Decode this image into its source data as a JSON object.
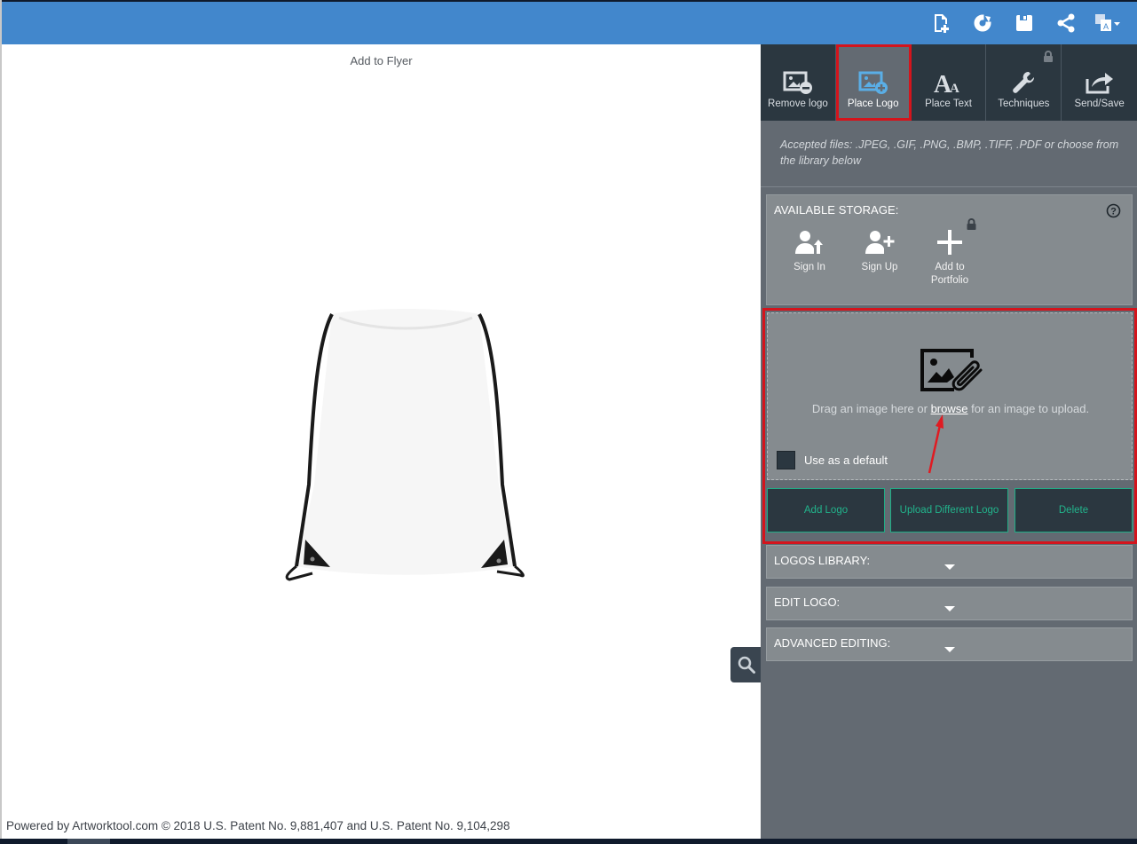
{
  "topbar": {
    "color": "#4287cc",
    "icons": [
      {
        "name": "new-document-icon"
      },
      {
        "name": "refresh-icon"
      },
      {
        "name": "save-icon"
      },
      {
        "name": "share-icon"
      },
      {
        "name": "translate-icon"
      }
    ]
  },
  "canvas": {
    "title": "Add to Flyer",
    "product": "white drawstring bag",
    "footer": "Powered by Artworktool.com © 2018 U.S. Patent No. 9,881,407 and U.S. Patent No. 9,104,298"
  },
  "tool_tabs": [
    {
      "label": "Remove logo",
      "icon": "remove-logo-icon",
      "active": false
    },
    {
      "label": "Place Logo",
      "icon": "place-logo-icon",
      "active": true
    },
    {
      "label": "Place Text",
      "icon": "place-text-icon",
      "active": false
    },
    {
      "label": "Techniques",
      "icon": "wrench-icon",
      "active": false,
      "locked": true
    },
    {
      "label": "Send/Save",
      "icon": "send-save-icon",
      "active": false
    }
  ],
  "panel": {
    "accepted_files": "Accepted files: .JPEG, .GIF, .PNG, .BMP, .TIFF, .PDF or choose from the library below",
    "storage": {
      "title": "AVAILABLE STORAGE:",
      "buttons": [
        {
          "label": "Sign In",
          "icon": "user-sign-in-icon"
        },
        {
          "label": "Sign Up",
          "icon": "user-add-icon"
        },
        {
          "label": "Add to Portfolio",
          "icon": "plus-icon",
          "locked": true
        }
      ]
    },
    "upload": {
      "text_before": "Drag an image here or ",
      "link": "browse",
      "text_after": " for an image to upload.",
      "default_label": "Use as a default",
      "default_checked": false
    },
    "actions": [
      {
        "label": "Add Logo"
      },
      {
        "label": "Upload Different Logo"
      },
      {
        "label": "Delete"
      }
    ],
    "accordions": [
      {
        "label": "LOGOS LIBRARY:"
      },
      {
        "label": "EDIT LOGO:"
      },
      {
        "label": "ADVANCED EDITING:"
      }
    ]
  },
  "colors": {
    "accent_highlight": "#d4141c",
    "action_text": "#22b48c",
    "panel_bg": "#636a72",
    "tabs_bg": "#2b3740"
  }
}
